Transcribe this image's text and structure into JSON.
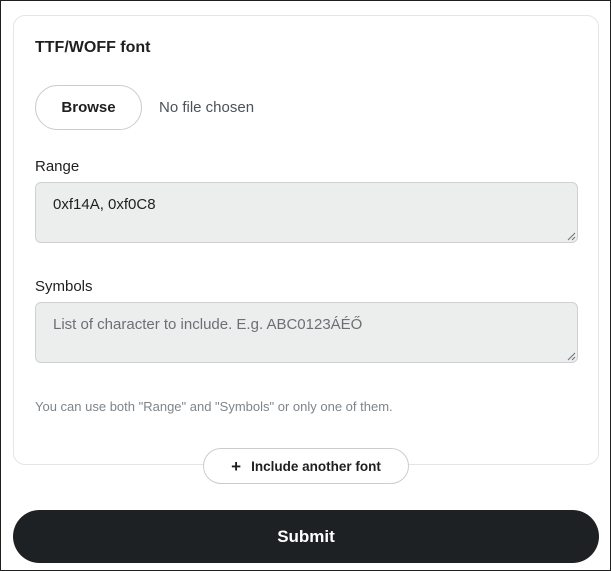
{
  "font_section": {
    "title": "TTF/WOFF font",
    "browse_label": "Browse",
    "file_status": "No file chosen",
    "range": {
      "label": "Range",
      "value": "0xf14A, 0xf0C8"
    },
    "symbols": {
      "label": "Symbols",
      "placeholder": "List of character to include. E.g. ABC0123ÁÉŐ"
    },
    "hint": "You can use both \"Range\" and \"Symbols\" or only one of them."
  },
  "include_another": {
    "icon": "plus-icon",
    "label": "Include another font"
  },
  "submit_label": "Submit"
}
